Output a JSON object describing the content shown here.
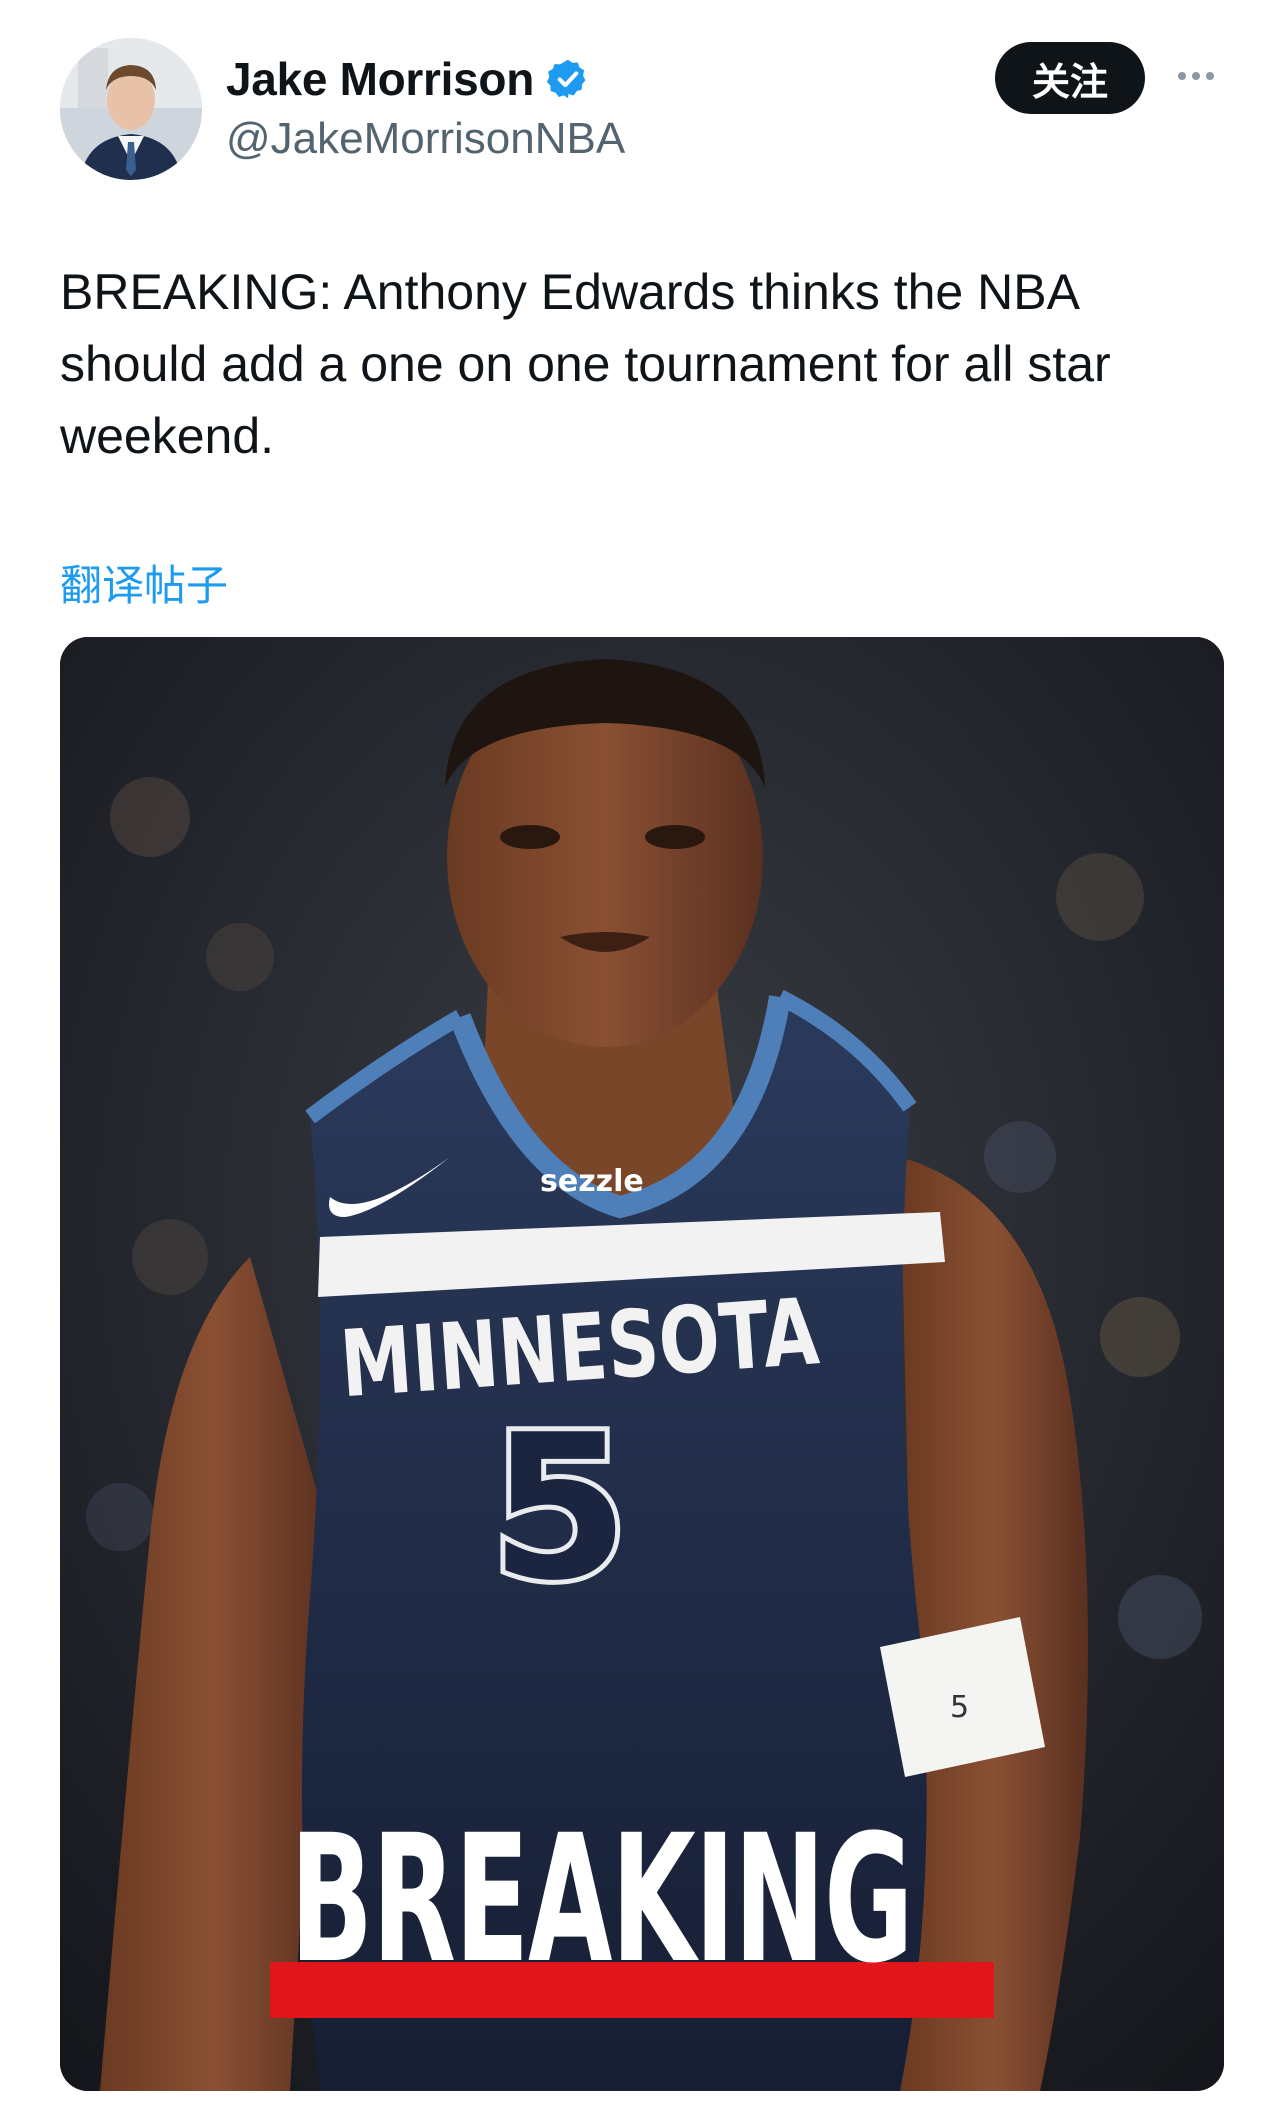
{
  "author": {
    "name": "Jake Morrison",
    "handle": "@JakeMorrisonNBA",
    "verified": true,
    "avatar_icon": "avatar-photo"
  },
  "actions": {
    "follow_label": "关注",
    "more_icon": "more-horizontal-icon"
  },
  "tweet": {
    "text": "BREAKING: Anthony Edwards thinks the NBA should add a one on one tournament for all star weekend.",
    "translate_label": "翻译帖子"
  },
  "media": {
    "jersey_sponsor": "sezzle",
    "jersey_team": "MINNESOTA",
    "jersey_number": "5",
    "wristband_number": "5",
    "banner_text": "BREAKING"
  },
  "colors": {
    "link": "#1d9bf0",
    "verified": "#1d9bf0",
    "follow_bg": "#0f1419",
    "banner_red": "#e0161b",
    "jersey_navy": "#1f2b45"
  }
}
